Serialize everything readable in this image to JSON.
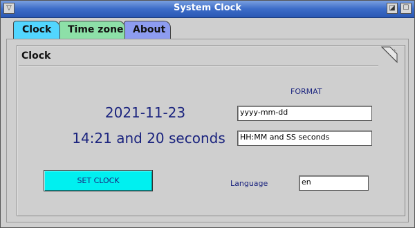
{
  "window": {
    "title": "System Clock"
  },
  "tabs": [
    {
      "label": "Clock",
      "active": true,
      "color": "#52d6ff"
    },
    {
      "label": "Time zone",
      "active": false,
      "color": "#8de0a8"
    },
    {
      "label": "About",
      "active": false,
      "color": "#8d9cf0"
    }
  ],
  "panel": {
    "header": "Clock",
    "date_display": "2021-11-23",
    "time_display": "14:21 and 20 seconds",
    "format_label": "FORMAT",
    "date_format": "yyyy-mm-dd",
    "time_format": "HH:MM and SS seconds",
    "set_button": "SET CLOCK",
    "language_label": "Language",
    "language_value": "en"
  },
  "icons": [
    "window-menu-icon",
    "maximize-icon",
    "close-icon",
    "page-corner-icon"
  ]
}
